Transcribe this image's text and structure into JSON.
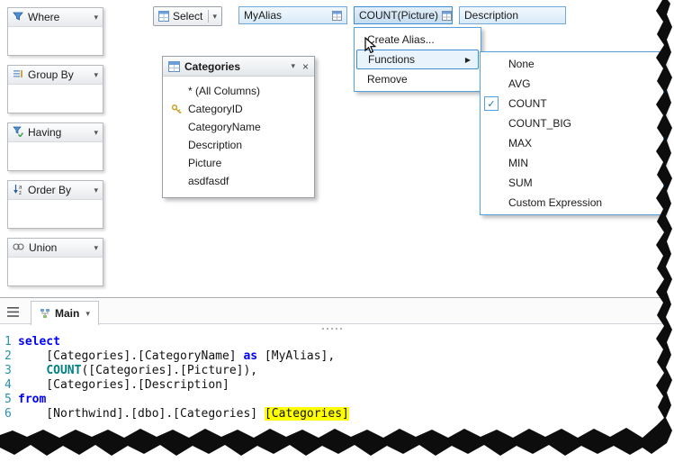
{
  "sidebar": {
    "panels": [
      {
        "label": "Where"
      },
      {
        "label": "Group By"
      },
      {
        "label": "Having"
      },
      {
        "label": "Order By"
      },
      {
        "label": "Union"
      }
    ]
  },
  "toolbar": {
    "select_label": "Select",
    "chips": [
      {
        "label": "MyAlias"
      },
      {
        "label": "COUNT(Picture)"
      },
      {
        "label": "Description"
      }
    ]
  },
  "context_menu": {
    "items": [
      {
        "label": "Create Alias..."
      },
      {
        "label": "Functions"
      },
      {
        "label": "Remove"
      }
    ]
  },
  "functions_submenu": {
    "check_glyph": "✓",
    "items": [
      {
        "label": "None"
      },
      {
        "label": "AVG"
      },
      {
        "label": "COUNT",
        "checked": true
      },
      {
        "label": "COUNT_BIG"
      },
      {
        "label": "MAX"
      },
      {
        "label": "MIN"
      },
      {
        "label": "SUM"
      },
      {
        "label": "Custom Expression"
      }
    ]
  },
  "table_card": {
    "title": "Categories",
    "rows": [
      {
        "label": "* (All Columns)"
      },
      {
        "label": "CategoryID"
      },
      {
        "label": "CategoryName"
      },
      {
        "label": "Description"
      },
      {
        "label": "Picture"
      },
      {
        "label": "asdfasdf"
      }
    ]
  },
  "editor": {
    "tab_label": "Main",
    "lines": [
      {
        "num": "1",
        "tokens": [
          {
            "t": "kw",
            "v": "select"
          }
        ]
      },
      {
        "num": "2",
        "tokens": [
          {
            "t": "plain",
            "v": "    [Categories].[CategoryName] "
          },
          {
            "t": "kw",
            "v": "as"
          },
          {
            "t": "plain",
            "v": " [MyAlias],"
          }
        ]
      },
      {
        "num": "3",
        "tokens": [
          {
            "t": "plain",
            "v": "    "
          },
          {
            "t": "fn",
            "v": "COUNT"
          },
          {
            "t": "plain",
            "v": "([Categories].[Picture]),"
          }
        ]
      },
      {
        "num": "4",
        "tokens": [
          {
            "t": "plain",
            "v": "    [Categories].[Description]"
          }
        ]
      },
      {
        "num": "5",
        "tokens": [
          {
            "t": "kw",
            "v": "from"
          }
        ]
      },
      {
        "num": "6",
        "tokens": [
          {
            "t": "plain",
            "v": "    [Northwind].[dbo].[Categories] "
          },
          {
            "t": "hl",
            "v": "[Categories]"
          }
        ]
      }
    ]
  },
  "glyphs": {
    "chevron_down": "▾",
    "submenu_arrow": "▶",
    "close": "×"
  },
  "colors": {
    "accent": "#52a0dd",
    "keyword": "#0000ff",
    "function": "#008080",
    "highlight": "#ffff00"
  }
}
